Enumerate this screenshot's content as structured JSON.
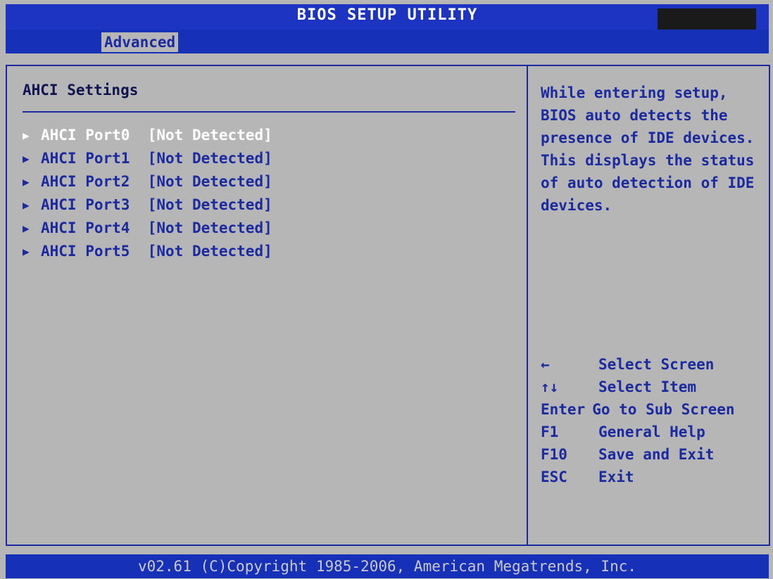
{
  "title": "BIOS SETUP UTILITY",
  "menu": {
    "active_tab": "Advanced"
  },
  "main": {
    "section_title": "AHCI Settings",
    "items": [
      {
        "label": "AHCI Port0",
        "status": "[Not Detected]",
        "selected": true
      },
      {
        "label": "AHCI Port1",
        "status": "[Not Detected]",
        "selected": false
      },
      {
        "label": "AHCI Port2",
        "status": "[Not Detected]",
        "selected": false
      },
      {
        "label": "AHCI Port3",
        "status": "[Not Detected]",
        "selected": false
      },
      {
        "label": "AHCI Port4",
        "status": "[Not Detected]",
        "selected": false
      },
      {
        "label": "AHCI Port5",
        "status": "[Not Detected]",
        "selected": false
      }
    ],
    "item_icon": "submenu-arrow-icon"
  },
  "help": {
    "text": "While entering setup, BIOS auto detects the presence of IDE devices. This displays the status of auto detection of IDE devices.",
    "keys": [
      {
        "key": "←",
        "action": "Select Screen"
      },
      {
        "key": "↑↓",
        "action": "Select Item"
      },
      {
        "key": "Enter",
        "action": "Go to Sub Screen"
      },
      {
        "key": "F1",
        "action": "General Help"
      },
      {
        "key": "F10",
        "action": "Save and Exit"
      },
      {
        "key": "ESC",
        "action": "Exit"
      }
    ]
  },
  "footer": {
    "copyright": "v02.61 (C)Copyright 1985-2006, American Megatrends, Inc."
  },
  "colors": {
    "bar_blue": "#1730b8",
    "text_blue": "#1b2a9e",
    "panel_gray": "#b6b6b6",
    "selected_text": "#ffffff"
  }
}
